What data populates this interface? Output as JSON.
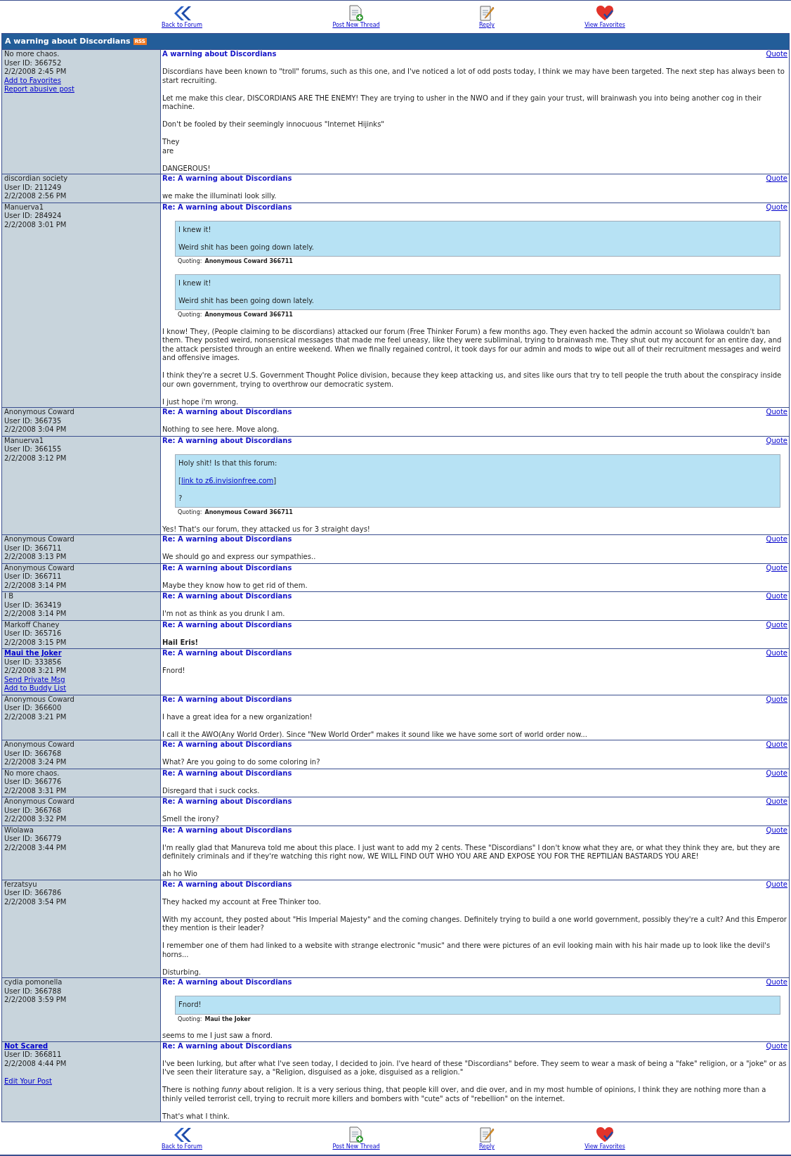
{
  "nav_top": [
    {
      "kind": "back",
      "label": "Back to Forum"
    },
    {
      "kind": "new_thread",
      "label": "Post New Thread"
    },
    {
      "kind": "reply",
      "label": "Reply"
    },
    {
      "kind": "favorites",
      "label": "View Favorites"
    }
  ],
  "thread": {
    "title": "A warning about Discordians",
    "rss": "RSS"
  },
  "posts": [
    {
      "author": "No more chaos.",
      "author_link": false,
      "user_id": "User ID: 366752",
      "date": "2/2/2008 2:45 PM",
      "links": [
        {
          "label": "Add to Favorites",
          "kind": "member"
        },
        {
          "label": "Report abusive post",
          "kind": "member"
        }
      ],
      "title": "A warning about Discordians",
      "quote_link": "Quote",
      "body": [
        {
          "kind": "text",
          "bold": false,
          "lines": [
            "Discordians have been known to \"troll\" forums, such as this one, and I've noticed a lot of odd posts today, I think we may have been targeted. The next step has always been to start recruiting."
          ]
        },
        {
          "kind": "text",
          "bold": false,
          "lines": [
            "Let me make this clear, DISCORDIANS ARE THE ENEMY! They are trying to usher in the NWO and if they gain your trust, will brainwash you into being another cog in their machine."
          ]
        },
        {
          "kind": "text",
          "bold": false,
          "lines": [
            "Don't be fooled by their seemingly innocuous \"Internet Hijinks\""
          ]
        },
        {
          "kind": "text",
          "bold": false,
          "lines": [
            "They",
            "are"
          ]
        },
        {
          "kind": "text",
          "bold": false,
          "lines": [
            "DANGEROUS!"
          ]
        }
      ]
    },
    {
      "author": "discordian society",
      "author_link": false,
      "user_id": "User ID: 211249",
      "date": "2/2/2008 2:56 PM",
      "title": "Re: A warning about Discordians",
      "quote_link": "Quote",
      "body": [
        {
          "kind": "text",
          "bold": false,
          "lines": [
            "we make the illuminati look silly."
          ]
        }
      ]
    },
    {
      "author": "Manuerva1",
      "author_link": false,
      "user_id": "User ID: 284924",
      "date": "2/2/2008 3:01 PM",
      "title": "Re: A warning about Discordians",
      "quote_link": "Quote",
      "body": [
        {
          "kind": "quote",
          "paragraphs": [
            {
              "kind": "text",
              "text": "I knew it!"
            },
            {
              "kind": "text",
              "text": "Weird shit has been going down lately."
            }
          ],
          "quoting_label": "Quoting:",
          "quoting_name": "Anonymous Coward 366711"
        },
        {
          "kind": "quote",
          "paragraphs": [
            {
              "kind": "text",
              "text": "I knew it!"
            },
            {
              "kind": "text",
              "text": "Weird shit has been going down lately."
            }
          ],
          "quoting_label": "Quoting:",
          "quoting_name": "Anonymous Coward 366711"
        },
        {
          "kind": "text",
          "bold": false,
          "lines": [
            "I know! They, (People claiming to be discordians) attacked our forum (Free Thinker Forum) a few months ago. They even hacked the admin account so Wiolawa couldn't ban them. They posted weird, nonsensical messages that made me feel uneasy, like they were subliminal, trying to brainwash me. They shut out my account for an entire day, and the attack persisted through an entire weekend. When we finally regained control, it took days for our admin and mods to wipe out all of their recruitment messages and weird and offensive images."
          ]
        },
        {
          "kind": "text",
          "bold": false,
          "lines": [
            "I think they're a secret U.S. Government Thought Police division, because they keep attacking us, and sites like ours that try to tell people the truth about the conspiracy inside our own government, trying to overthrow our democratic system."
          ]
        },
        {
          "kind": "text",
          "bold": false,
          "lines": [
            "I just hope i'm wrong."
          ]
        }
      ]
    },
    {
      "author": "Anonymous Coward",
      "author_link": false,
      "user_id": "User ID: 366735",
      "date": "2/2/2008 3:04 PM",
      "title": "Re: A warning about Discordians",
      "quote_link": "Quote",
      "body": [
        {
          "kind": "text",
          "bold": false,
          "lines": [
            "Nothing to see here. Move along."
          ]
        }
      ]
    },
    {
      "author": "Manuerva1",
      "author_link": false,
      "user_id": "User ID: 366155",
      "date": "2/2/2008 3:12 PM",
      "title": "Re: A warning about Discordians",
      "quote_link": "Quote",
      "body": [
        {
          "kind": "quote",
          "paragraphs": [
            {
              "kind": "text",
              "text": "Holy shit! Is that this forum:"
            },
            {
              "kind": "link",
              "before": "[",
              "link": "link to z6.invisionfree.com",
              "after": "]"
            },
            {
              "kind": "text",
              "text": "?"
            }
          ],
          "quoting_label": "Quoting:",
          "quoting_name": "Anonymous Coward 366711"
        },
        {
          "kind": "text",
          "bold": false,
          "lines": [
            "Yes! That's our forum, they attacked us for 3 straight days!"
          ]
        }
      ]
    },
    {
      "author": "Anonymous Coward",
      "author_link": false,
      "user_id": "User ID: 366711",
      "date": "2/2/2008 3:13 PM",
      "title": "Re: A warning about Discordians",
      "quote_link": "Quote",
      "body": [
        {
          "kind": "text",
          "bold": false,
          "lines": [
            "We should go and express our sympathies.."
          ]
        }
      ]
    },
    {
      "author": "Anonymous Coward",
      "author_link": false,
      "user_id": "User ID: 366711",
      "date": "2/2/2008 3:14 PM",
      "title": "Re: A warning about Discordians",
      "quote_link": "Quote",
      "body": [
        {
          "kind": "text",
          "bold": false,
          "lines": [
            "Maybe they know how to get rid of them."
          ]
        }
      ]
    },
    {
      "author": "I B",
      "author_link": false,
      "user_id": "User ID: 363419",
      "date": "2/2/2008 3:14 PM",
      "title": "Re: A warning about Discordians",
      "quote_link": "Quote",
      "body": [
        {
          "kind": "text",
          "bold": false,
          "lines": [
            "I'm not as think as you drunk I am."
          ]
        }
      ]
    },
    {
      "author": "Markoff Chaney",
      "author_link": false,
      "user_id": "User ID: 365716",
      "date": "2/2/2008 3:15 PM",
      "title": "Re: A warning about Discordians",
      "quote_link": "Quote",
      "body": [
        {
          "kind": "text",
          "bold": true,
          "lines": [
            "Hail Eris!"
          ]
        }
      ]
    },
    {
      "author": "Maui the Joker",
      "author_link": true,
      "user_id": "User ID: 333856",
      "date": "2/2/2008 3:21 PM",
      "links": [
        {
          "label": "Send Private Msg",
          "kind": "member"
        },
        {
          "label": "Add to Buddy List",
          "kind": "member"
        }
      ],
      "title": "Re: A warning about Discordians",
      "quote_link": "Quote",
      "body": [
        {
          "kind": "text",
          "bold": false,
          "lines": [
            "Fnord!"
          ]
        }
      ]
    },
    {
      "author": "Anonymous Coward",
      "author_link": false,
      "user_id": "User ID: 366600",
      "date": "2/2/2008 3:21 PM",
      "title": "Re: A warning about Discordians",
      "quote_link": "Quote",
      "body": [
        {
          "kind": "text",
          "bold": false,
          "lines": [
            "I have a great idea for a new organization!"
          ]
        },
        {
          "kind": "text",
          "bold": false,
          "lines": [
            "I call it the AWO(Any World Order). Since \"New World Order\" makes it sound like we have some sort of world order now..."
          ]
        }
      ]
    },
    {
      "author": "Anonymous Coward",
      "author_link": false,
      "user_id": "User ID: 366768",
      "date": "2/2/2008 3:24 PM",
      "title": "Re: A warning about Discordians",
      "quote_link": "Quote",
      "body": [
        {
          "kind": "text",
          "bold": false,
          "lines": [
            "What? Are you going to do some coloring in?"
          ]
        }
      ]
    },
    {
      "author": "No more chaos.",
      "author_link": false,
      "user_id": "User ID: 366776",
      "date": "2/2/2008 3:31 PM",
      "title": "Re: A warning about Discordians",
      "quote_link": "Quote",
      "body": [
        {
          "kind": "text",
          "bold": false,
          "lines": [
            "Disregard that i suck cocks."
          ]
        }
      ]
    },
    {
      "author": "Anonymous Coward",
      "author_link": false,
      "user_id": "User ID: 366768",
      "date": "2/2/2008 3:32 PM",
      "title": "Re: A warning about Discordians",
      "quote_link": "Quote",
      "body": [
        {
          "kind": "text",
          "bold": false,
          "lines": [
            "Smell the irony?"
          ]
        }
      ]
    },
    {
      "author": "Wiolawa",
      "author_link": false,
      "user_id": "User ID: 366779",
      "date": "2/2/2008 3:44 PM",
      "title": "Re: A warning about Discordians",
      "quote_link": "Quote",
      "body": [
        {
          "kind": "text",
          "bold": false,
          "lines": [
            "I'm really glad that Manureva told me about this place. I just want to add my 2 cents. These \"Discordians\" I don't know what they are, or what they think they are, but they are definitely criminals and if they're watching this right now, WE WILL FIND OUT WHO YOU ARE AND EXPOSE YOU FOR THE REPTILIAN BASTARDS YOU ARE!"
          ]
        },
        {
          "kind": "text",
          "bold": false,
          "lines": [
            "ah ho Wio"
          ]
        }
      ]
    },
    {
      "author": "ferzatsyu",
      "author_link": false,
      "user_id": "User ID: 366786",
      "date": "2/2/2008 3:54 PM",
      "title": "Re: A warning about Discordians",
      "quote_link": "Quote",
      "body": [
        {
          "kind": "text",
          "bold": false,
          "lines": [
            "They hacked my account at Free Thinker too."
          ]
        },
        {
          "kind": "text",
          "bold": false,
          "lines": [
            "With my account, they posted about \"His Imperial Majesty\" and the coming changes. Definitely trying to build a one world government, possibly they're a cult? And this Emperor they mention is their leader?"
          ]
        },
        {
          "kind": "text",
          "bold": false,
          "lines": [
            "I remember one of them had linked to a website with strange electronic \"music\" and there were pictures of an evil looking main with his hair made up to look like the devil's horns..."
          ]
        },
        {
          "kind": "text",
          "bold": false,
          "lines": [
            "Disturbing."
          ]
        }
      ]
    },
    {
      "author": "cydia pomonella",
      "author_link": false,
      "user_id": "User ID: 366788",
      "date": "2/2/2008 3:59 PM",
      "title": "Re: A warning about Discordians",
      "quote_link": "Quote",
      "body": [
        {
          "kind": "quote",
          "paragraphs": [
            {
              "kind": "text",
              "text": "Fnord!"
            }
          ],
          "quoting_label": "Quoting:",
          "quoting_name": "Maui the Joker"
        },
        {
          "kind": "text",
          "bold": false,
          "lines": [
            "seems to me I just saw a fnord."
          ]
        }
      ]
    },
    {
      "author": "Not Scared",
      "author_link": true,
      "user_id": "User ID: 366811",
      "date": "2/2/2008 4:44 PM",
      "links": [
        {
          "label": "Edit Your Post",
          "kind": "edit"
        }
      ],
      "title": "Re: A warning about Discordians",
      "quote_link": "Quote",
      "body": [
        {
          "kind": "text",
          "bold": false,
          "lines": [
            "I've been lurking, but after what I've seen today, I decided to join. I've heard of these \"Discordians\" before. They seem to wear a mask of being a \"fake\" religion, or a \"joke\" or as I've seen their literature say, a \"Religion, disguised as a joke, disguised as a religion.\""
          ]
        },
        {
          "kind": "text",
          "bold": false,
          "lines": [
            "There is nothing *funny* about religion. It is a very serious thing, that people kill over, and die over, and in my most humble of opinions, I think they are nothing more than a thinly veiled terrorist cell, trying to recruit more killers and bombers with \"cute\" acts of \"rebellion\" on the internet."
          ]
        },
        {
          "kind": "text",
          "bold": false,
          "lines": [
            "That's what I think."
          ]
        }
      ]
    }
  ],
  "nav_bottom": [
    {
      "kind": "back",
      "label": "Back to Forum"
    },
    {
      "kind": "new_thread",
      "label": "Post New Thread"
    },
    {
      "kind": "reply",
      "label": "Reply"
    },
    {
      "kind": "favorites",
      "label": "View Favorites"
    }
  ]
}
